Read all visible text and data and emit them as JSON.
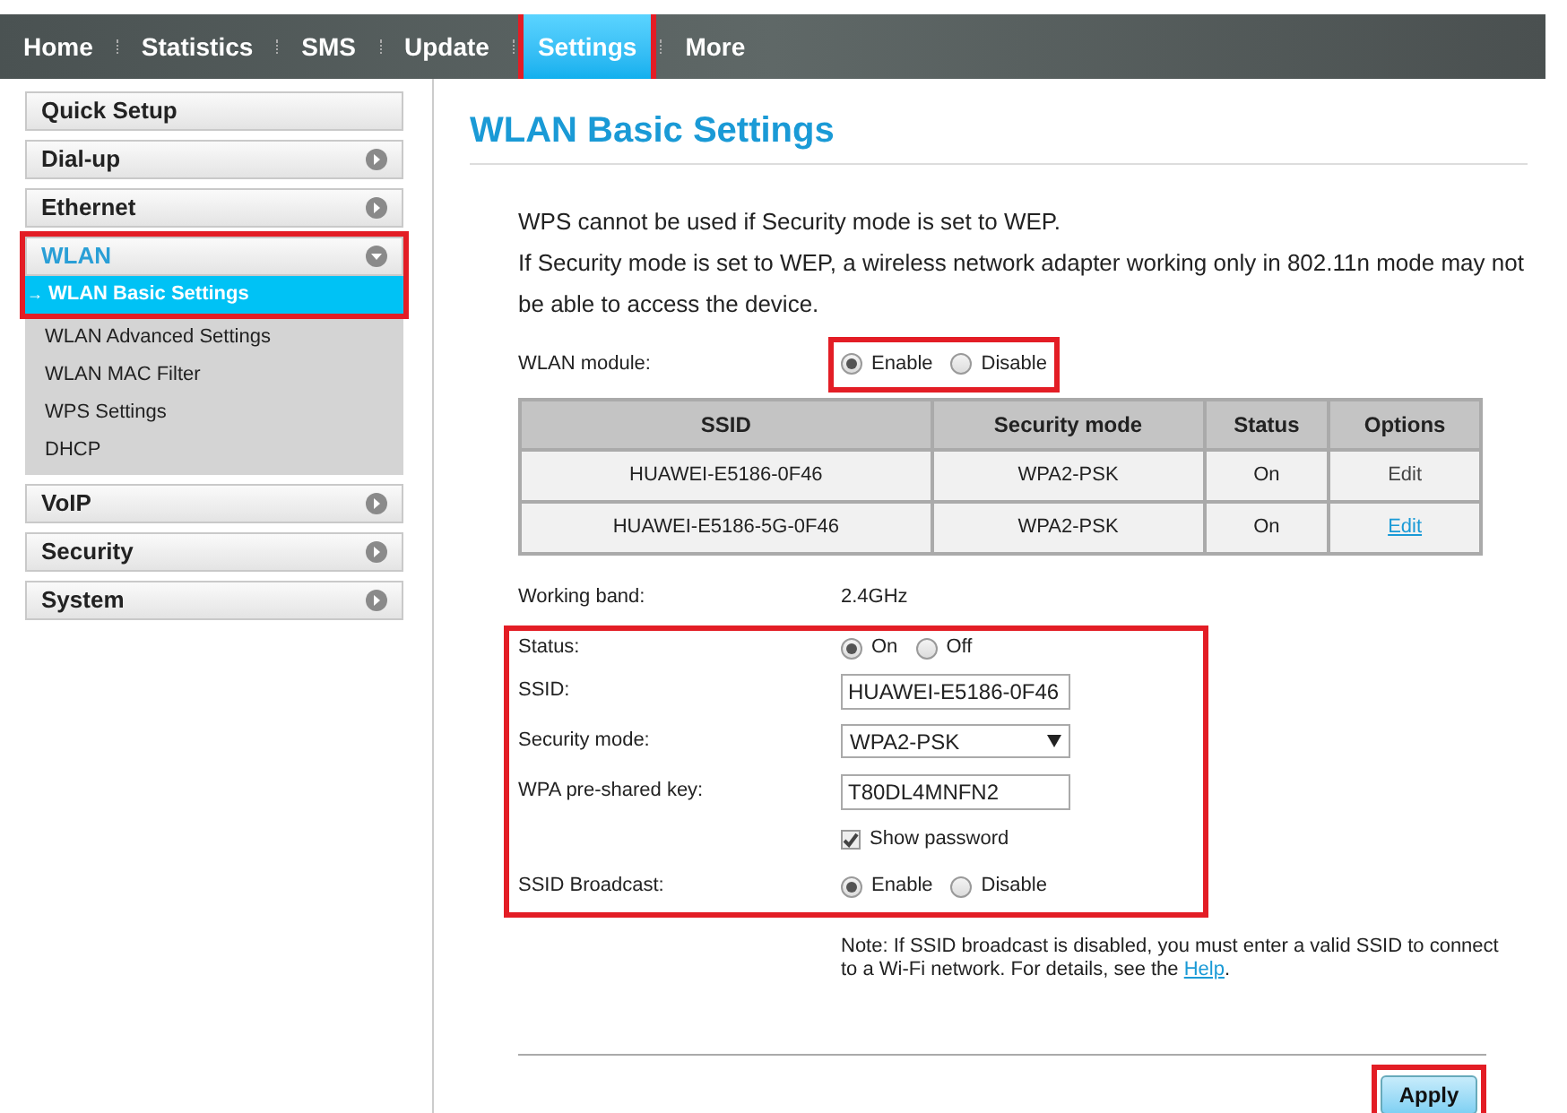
{
  "nav": [
    {
      "label": "Home",
      "selected": false,
      "highlighted": false
    },
    {
      "label": "Statistics",
      "selected": false,
      "highlighted": false
    },
    {
      "label": "SMS",
      "selected": false,
      "highlighted": false
    },
    {
      "label": "Update",
      "selected": false,
      "highlighted": false
    },
    {
      "label": "Settings",
      "selected": true,
      "highlighted": true
    },
    {
      "label": "More",
      "selected": false,
      "highlighted": false
    }
  ],
  "sidebar": [
    {
      "label": "Quick Setup",
      "kind": "plain"
    },
    {
      "label": "Dial-up",
      "kind": "group",
      "expanded": false
    },
    {
      "label": "Ethernet",
      "kind": "group",
      "expanded": false
    },
    {
      "label": "WLAN",
      "kind": "group",
      "expanded": true,
      "highlighted": true,
      "children": [
        {
          "label": "WLAN Basic Settings",
          "selected": true,
          "marker": "→"
        },
        {
          "label": "WLAN Advanced Settings",
          "selected": false
        },
        {
          "label": "WLAN MAC Filter",
          "selected": false
        },
        {
          "label": "WPS Settings",
          "selected": false
        },
        {
          "label": "DHCP",
          "selected": false
        }
      ]
    },
    {
      "label": "VoIP",
      "kind": "group",
      "expanded": false
    },
    {
      "label": "Security",
      "kind": "group",
      "expanded": false
    },
    {
      "label": "System",
      "kind": "group",
      "expanded": false
    }
  ],
  "page_title": "WLAN Basic Settings",
  "intro": [
    "WPS cannot be used if Security mode is set to WEP.",
    "If Security mode is set to WEP, a wireless network adapter working only in 802.11n mode may not be able to access the device."
  ],
  "wlan_module": {
    "label": "WLAN module:",
    "highlighted": true,
    "options": [
      {
        "label": "Enable",
        "selected": true
      },
      {
        "label": "Disable",
        "selected": false
      }
    ]
  },
  "table": {
    "columns": [
      "SSID",
      "Security mode",
      "Status",
      "Options"
    ],
    "rows": [
      {
        "cells": [
          "HUAWEI-E5186-0F46",
          "WPA2-PSK",
          "On"
        ],
        "edit": {
          "label": "Edit",
          "hovered": false
        }
      },
      {
        "cells": [
          "HUAWEI-E5186-5G-0F46",
          "WPA2-PSK",
          "On"
        ],
        "edit": {
          "label": "Edit",
          "hovered": true
        }
      }
    ]
  },
  "working_band": {
    "label": "Working band:",
    "value": "2.4GHz"
  },
  "form": {
    "highlighted": true,
    "fields": [
      {
        "kind": "radio",
        "label": "Status:",
        "options": [
          {
            "label": "On",
            "selected": true
          },
          {
            "label": "Off",
            "selected": false
          }
        ]
      },
      {
        "kind": "text",
        "label": "SSID:",
        "value": "HUAWEI-E5186-0F46"
      },
      {
        "kind": "select",
        "label": "Security mode:",
        "value": "WPA2-PSK"
      },
      {
        "kind": "text",
        "label": "WPA pre-shared key:",
        "value": "T80DL4MNFN2"
      },
      {
        "kind": "checkbox",
        "label": "Show password",
        "checked": true
      },
      {
        "kind": "radio",
        "label": "SSID Broadcast:",
        "options": [
          {
            "label": "Enable",
            "selected": true
          },
          {
            "label": "Disable",
            "selected": false
          }
        ]
      }
    ]
  },
  "note": {
    "text": "Note: If SSID broadcast is disabled, you must enter a valid SSID to connect to a Wi-Fi network. For details, see the",
    "link": "Help",
    "after": "."
  },
  "apply": {
    "label": "Apply",
    "highlighted": true
  }
}
